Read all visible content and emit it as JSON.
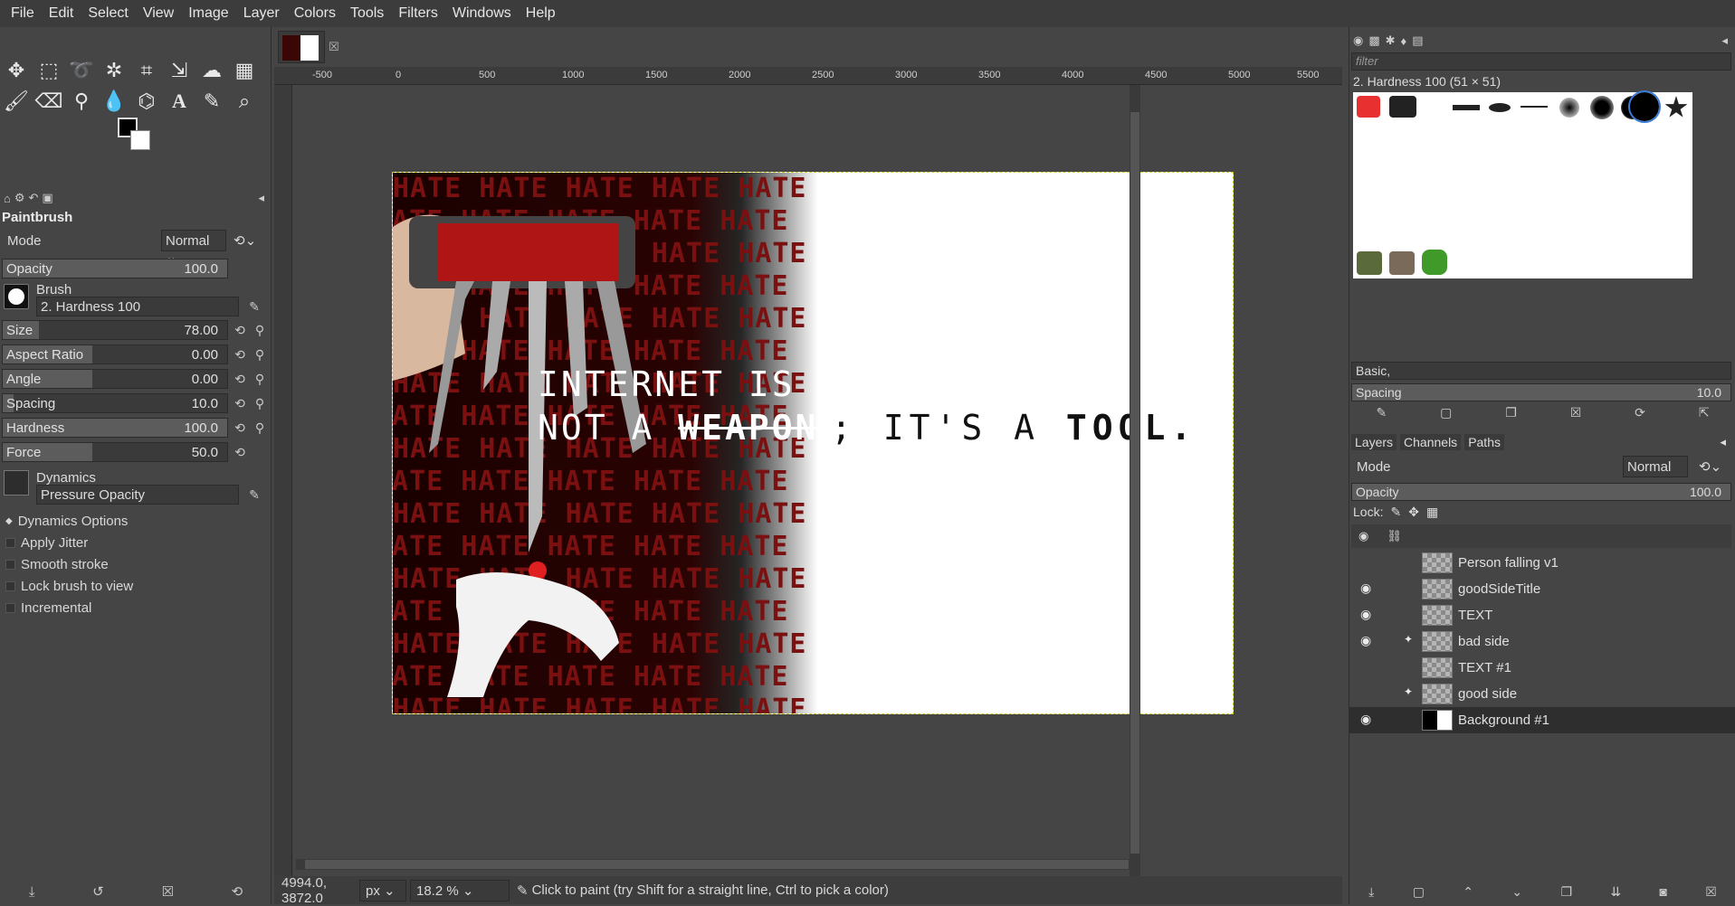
{
  "menubar": {
    "items": [
      "File",
      "Edit",
      "Select",
      "View",
      "Image",
      "Layer",
      "Colors",
      "Tools",
      "Filters",
      "Windows",
      "Help"
    ]
  },
  "toolbox": {
    "tools_row1": [
      "move-tool-icon",
      "rect-select-icon",
      "lasso-icon",
      "fuzzy-select-icon",
      "crop-icon",
      "unified-transform-icon",
      "warp-icon",
      "grid-icon"
    ],
    "tools_row2": [
      "paintbrush-icon",
      "eraser-icon",
      "clone-icon",
      "smudge-icon",
      "paths-icon",
      "text-icon",
      "color-picker-icon",
      "zoom-icon"
    ]
  },
  "tool_options": {
    "title": "Paintbrush",
    "mode_label": "Mode",
    "mode_value": "Normal",
    "opacity_label": "Opacity",
    "opacity_value": "100.0",
    "brush_label": "Brush",
    "brush_value": "2. Hardness 100",
    "sliders": [
      {
        "label": "Size",
        "value": "78.00",
        "fill": 0.16
      },
      {
        "label": "Aspect Ratio",
        "value": "0.00",
        "fill": 0.4
      },
      {
        "label": "Angle",
        "value": "0.00",
        "fill": 0.4
      },
      {
        "label": "Spacing",
        "value": "10.0",
        "fill": 0.05
      },
      {
        "label": "Hardness",
        "value": "100.0",
        "fill": 1.0
      },
      {
        "label": "Force",
        "value": "50.0",
        "fill": 0.4
      }
    ],
    "dynamics_label": "Dynamics",
    "dynamics_value": "Pressure Opacity",
    "checks": [
      "Dynamics Options",
      "Apply Jitter",
      "Smooth stroke",
      "Lock brush to view",
      "Incremental"
    ]
  },
  "ruler": {
    "ticks": [
      "-500",
      "0",
      "500",
      "1000",
      "1500",
      "2000",
      "2500",
      "3000",
      "3500",
      "4000",
      "4500",
      "5000",
      "5500"
    ]
  },
  "canvas": {
    "headline_l1": "INTERNET IS",
    "headline_l2a": "NOT A ",
    "headline_l2b": "WEAPON",
    "tagline_a": "; IT'S A ",
    "tagline_b": "TOOL.",
    "hate_word": "HATE HATE HATE HATE HATE"
  },
  "status": {
    "coords": "4994.0, 3872.0",
    "unit": "px",
    "zoom": "18.2 %",
    "message": "Click to paint (try Shift for a straight line, Ctrl to pick a color)"
  },
  "brushes": {
    "filter_placeholder": "filter",
    "selected": "2. Hardness 100 (51 × 51)",
    "tag": "Basic,",
    "spacing_label": "Spacing",
    "spacing_value": "10.0"
  },
  "layers": {
    "tabs": [
      "Layers",
      "Channels",
      "Paths"
    ],
    "mode_label": "Mode",
    "mode_value": "Normal",
    "opacity_label": "Opacity",
    "opacity_value": "100.0",
    "lock_label": "Lock:",
    "items": [
      {
        "name": "Person falling v1",
        "visible": false,
        "chained": false
      },
      {
        "name": "goodSideTitle",
        "visible": true,
        "chained": false
      },
      {
        "name": "TEXT",
        "visible": true,
        "chained": false
      },
      {
        "name": "bad side",
        "visible": true,
        "chained": true
      },
      {
        "name": "TEXT #1",
        "visible": false,
        "chained": false
      },
      {
        "name": "good side",
        "visible": false,
        "chained": true
      },
      {
        "name": "Background #1",
        "visible": true,
        "chained": false
      }
    ]
  },
  "colors": {
    "accent": "#cfcf2a",
    "bg": "#454545",
    "hate_red": "#7a1010"
  }
}
